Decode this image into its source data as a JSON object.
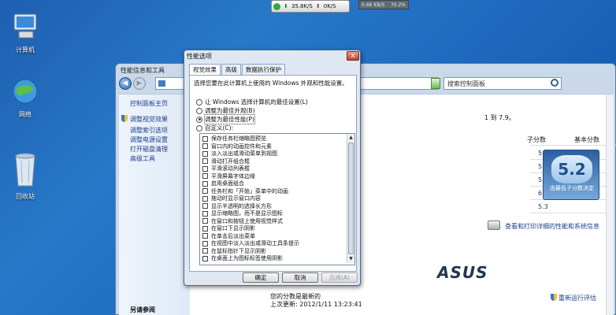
{
  "desktop": {
    "icons": [
      {
        "label": "计算机"
      },
      {
        "label": "网络"
      },
      {
        "label": "回收站"
      }
    ]
  },
  "netmeter": {
    "down": "35.8K/S",
    "up": "0K/S",
    "graph_left": "0.6K KB/S",
    "graph_right": "70.2%"
  },
  "main_window": {
    "title": "性能信息和工具",
    "search_placeholder": "搜索控制面板",
    "sidebar": {
      "home": "控制面板主页",
      "links": [
        "调整视觉效果",
        "调整索引选项",
        "调整电源设置",
        "打开磁盘清理",
        "高级工具"
      ],
      "see_also_header": "另请参阅"
    },
    "content": {
      "partial_text": "1 到 7.9。",
      "col_subscore": "子分数",
      "col_basescore": "基本分数",
      "subscores": [
        "5.5",
        "5.5",
        "5.2",
        "6.2",
        "5.3"
      ],
      "base_score": "5.2",
      "base_caption": "由最低子分数决定",
      "print_link": "查看和打印详细的性能和系统信息",
      "brand": "ASUS",
      "score_status": "您的分数是最新的",
      "last_update": "上次更新: 2012/1/11 13:23:41",
      "rerun": "重新运行评估"
    }
  },
  "dialog": {
    "title": "性能选项",
    "close": "x",
    "tabs": [
      "视觉效果",
      "高级",
      "数据执行保护"
    ],
    "description": "选择您要在此计算机上使用的 Windows 外观和性能设置。",
    "radios": [
      {
        "label": "让 Windows 选择计算机的最佳设置(L)",
        "selected": false
      },
      {
        "label": "调整为最佳外观(B)",
        "selected": false
      },
      {
        "label": "调整为最佳性能(P)",
        "selected": true
      },
      {
        "label": "自定义(C):",
        "selected": false
      }
    ],
    "effects": [
      "保存任务栏缩略图预览",
      "窗口内的动画控件和元素",
      "淡入淡出或滑动菜单到视图",
      "滑动打开组合框",
      "平滑滚动列表框",
      "平滑屏幕字体边缘",
      "启用桌面组合",
      "任务栏和「开始」菜单中的动画",
      "拖动时显示窗口内容",
      "显示半透明的选择长方形",
      "显示缩略图，而不是显示图标",
      "在窗口和按钮上使用视觉样式",
      "在窗口下显示阴影",
      "在单击后淡出菜单",
      "在视图中淡入淡出或滑动工具条提示",
      "在鼠标指针下显示阴影",
      "在桌面上为图标标签使用阴影"
    ],
    "buttons": {
      "ok": "确定",
      "cancel": "取消",
      "apply": "应用(A)"
    }
  }
}
